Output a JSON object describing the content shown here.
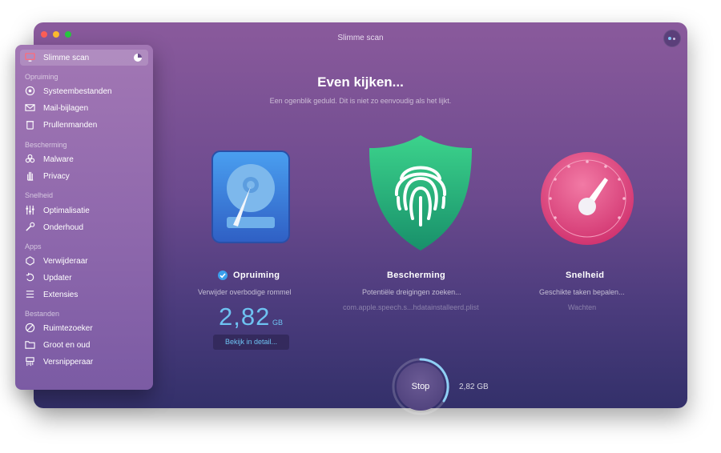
{
  "window": {
    "title": "Slimme scan"
  },
  "sidebar": {
    "top_item": {
      "label": "Slimme scan",
      "icon": "monitor-icon"
    },
    "sections": [
      {
        "heading": "Opruiming",
        "items": [
          {
            "label": "Systeembestanden",
            "icon": "gear-disc-icon"
          },
          {
            "label": "Mail-bijlagen",
            "icon": "envelope-icon"
          },
          {
            "label": "Prullenmanden",
            "icon": "trash-bin-icon"
          }
        ]
      },
      {
        "heading": "Bescherming",
        "items": [
          {
            "label": "Malware",
            "icon": "biohazard-icon"
          },
          {
            "label": "Privacy",
            "icon": "hand-icon"
          }
        ]
      },
      {
        "heading": "Snelheid",
        "items": [
          {
            "label": "Optimalisatie",
            "icon": "sliders-icon"
          },
          {
            "label": "Onderhoud",
            "icon": "wrench-icon"
          }
        ]
      },
      {
        "heading": "Apps",
        "items": [
          {
            "label": "Verwijderaar",
            "icon": "apps-icon"
          },
          {
            "label": "Updater",
            "icon": "update-icon"
          },
          {
            "label": "Extensies",
            "icon": "extensions-icon"
          }
        ]
      },
      {
        "heading": "Bestanden",
        "items": [
          {
            "label": "Ruimtezoeker",
            "icon": "space-lens-icon"
          },
          {
            "label": "Groot en oud",
            "icon": "folder-icon"
          },
          {
            "label": "Versnipperaar",
            "icon": "shredder-icon"
          }
        ]
      }
    ]
  },
  "main": {
    "headline": "Even kijken...",
    "subline": "Een ogenblik geduld. Dit is niet zo eenvoudig als het lijkt.",
    "cards": [
      {
        "title": "Opruiming",
        "subtitle": "Verwijder overbodige rommel",
        "amount": "2,82",
        "unit": "GB",
        "detail_button": "Bekijk in detail..."
      },
      {
        "title": "Bescherming",
        "subtitle": "Potentiële dreigingen zoeken...",
        "file": "com.apple.speech.s...hdatainstalleerd.plist"
      },
      {
        "title": "Snelheid",
        "subtitle": "Geschikte taken bepalen...",
        "status": "Wachten"
      }
    ],
    "stop_label": "Stop",
    "stop_size": "2,82 GB"
  },
  "colors": {
    "accent": "#6ec3f2",
    "window_top": "#8a5a9c",
    "window_bottom": "#33306a",
    "shield_green": "#2fb27a",
    "speed_pink": "#e0457f",
    "disk_blue": "#3f8ee0"
  }
}
